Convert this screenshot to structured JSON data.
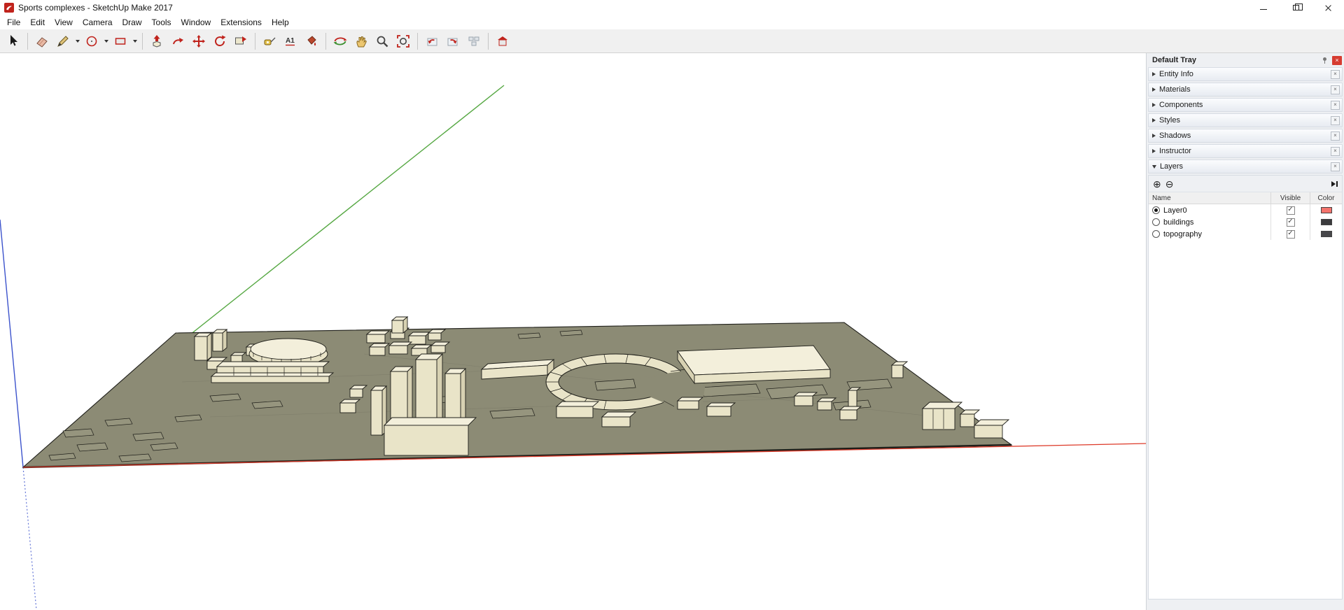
{
  "window": {
    "title": "Sports complexes - SketchUp Make 2017"
  },
  "menu": {
    "items": [
      "File",
      "Edit",
      "View",
      "Camera",
      "Draw",
      "Tools",
      "Window",
      "Extensions",
      "Help"
    ]
  },
  "toolbar": {
    "tools": [
      "select",
      "eraser",
      "line",
      "shapes",
      "rectangle",
      "push-pull",
      "follow-me",
      "move",
      "rotate",
      "make-component",
      "tape-measure",
      "text",
      "paint-bucket",
      "orbit",
      "pan",
      "zoom",
      "zoom-extents",
      "previous-view",
      "next-view",
      "standard-views",
      "3d-warehouse"
    ],
    "text_tool_glyph": "A1"
  },
  "glyphs": {
    "close": "×",
    "add": "⊕",
    "remove": "⊖",
    "check": "✓"
  },
  "tray": {
    "title": "Default Tray",
    "sections": [
      {
        "label": "Entity Info"
      },
      {
        "label": "Materials"
      },
      {
        "label": "Components"
      },
      {
        "label": "Styles"
      },
      {
        "label": "Shadows"
      },
      {
        "label": "Instructor"
      }
    ],
    "layers": {
      "title": "Layers",
      "columns": [
        "Name",
        "Visible",
        "Color"
      ],
      "rows": [
        {
          "name": "Layer0",
          "selected": true,
          "visible": true,
          "color": "#f4736c"
        },
        {
          "name": "buildings",
          "selected": false,
          "visible": true,
          "color": "#3b3b3d"
        },
        {
          "name": "topography",
          "selected": false,
          "visible": true,
          "color": "#47474a"
        }
      ]
    }
  },
  "scene": {
    "colors": {
      "terrain": "#8c8b75",
      "terrain-light": "#96957e",
      "building-front": "#e9e4c8",
      "building-top": "#f3efdb",
      "building-side": "#d7d1b2",
      "edge": "#1f1f1a",
      "axis-red": "#dd3a29",
      "axis-green": "#56a843",
      "axis-blue": "#3c53cc"
    }
  }
}
